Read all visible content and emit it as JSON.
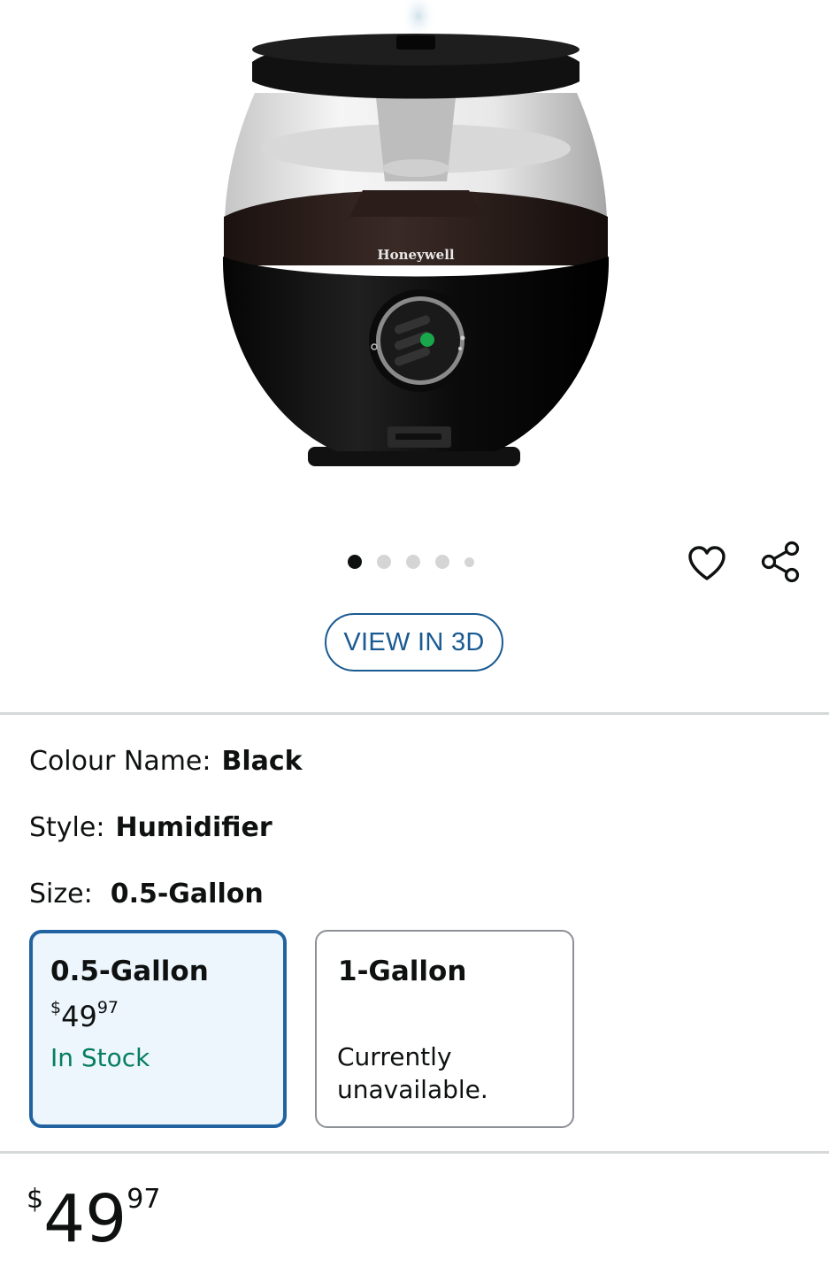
{
  "product": {
    "brand_mark": "Honeywell"
  },
  "carousel": {
    "total_dots": 5,
    "active_index": 0
  },
  "actions": {
    "wishlist_icon": "heart-outline-icon",
    "share_icon": "share-icon",
    "view_3d_label": "VIEW IN 3D"
  },
  "variations": {
    "colour": {
      "label": "Colour Name:",
      "value": "Black"
    },
    "style": {
      "label": "Style:",
      "value": "Humidifier"
    },
    "size": {
      "label": "Size:",
      "value": "0.5-Gallon"
    }
  },
  "size_options": [
    {
      "name": "0.5-Gallon",
      "selected": true,
      "currency": "$",
      "price_whole": "49",
      "price_fraction": "97",
      "availability": "In Stock"
    },
    {
      "name": "1-Gallon",
      "selected": false,
      "availability": "Currently unavailable."
    }
  ],
  "price": {
    "currency": "$",
    "whole": "49",
    "fraction": "97"
  },
  "colors": {
    "accent_blue": "#2162a1",
    "link_blue": "#1a5a92",
    "in_stock_green": "#067d62",
    "selected_tile_bg": "#edf6fd",
    "divider": "#d5d9d9"
  }
}
